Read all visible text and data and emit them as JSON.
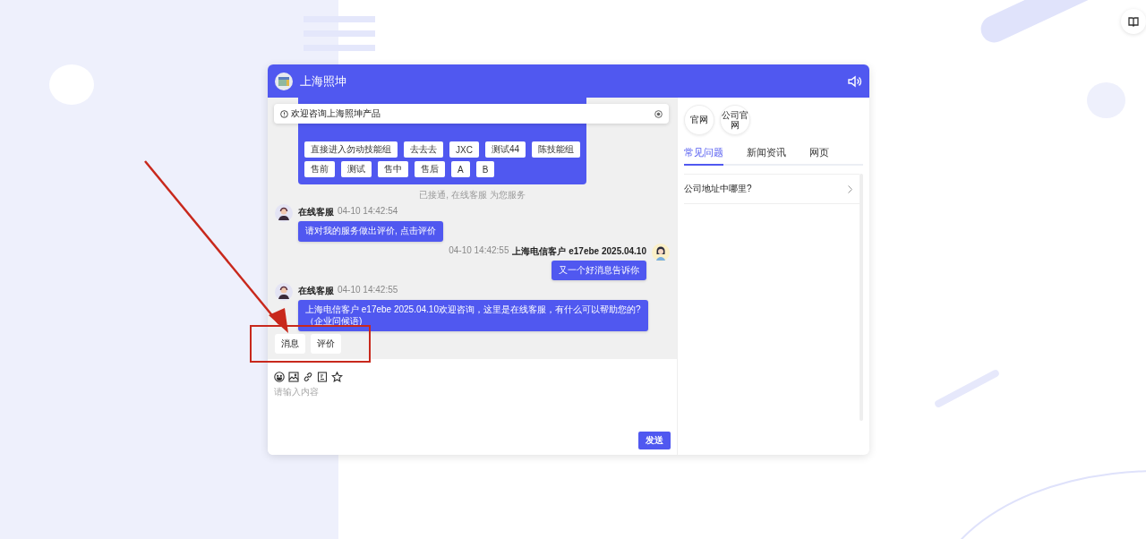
{
  "window": {
    "title": "上海照坤",
    "notice": "欢迎咨询上海照坤产品"
  },
  "skill_groups": [
    [
      "直接进入勿动技能组",
      "去去去",
      "JXC",
      "测试44",
      "陈技能组"
    ],
    [
      "售前",
      "测试",
      "售中",
      "售后",
      "A",
      "B"
    ]
  ],
  "system_message": "已接通, 在线客服 为您服务",
  "messages": [
    {
      "kind": "agent",
      "sender": "在线客服",
      "time": "04-10 14:42:54",
      "lines": [
        "请对我的服务做出评价, 点击评价"
      ]
    },
    {
      "kind": "customer",
      "sender": "上海电信客户 e17ebe 2025.04.10",
      "time": "04-10 14:42:55",
      "lines": [
        "又一个好消息告诉你"
      ]
    },
    {
      "kind": "agent",
      "sender": "在线客服",
      "time": "04-10 14:42:55",
      "lines": [
        "上海电信客户 e17ebe 2025.04.10欢迎咨询，这里是在线客服，有什么可以帮助您的?",
        "（企业问候语)"
      ]
    }
  ],
  "quick_replies": [
    "消息",
    "评价"
  ],
  "composer": {
    "placeholder": "请输入内容",
    "send": "发送"
  },
  "side_panel": {
    "links": [
      "官网",
      "公司官网"
    ],
    "tabs": [
      {
        "label": "常见问题",
        "selected": true
      },
      {
        "label": "新闻资讯",
        "selected": false
      },
      {
        "label": "网页",
        "selected": false
      }
    ],
    "faq": [
      "公司地址中哪里?"
    ]
  }
}
